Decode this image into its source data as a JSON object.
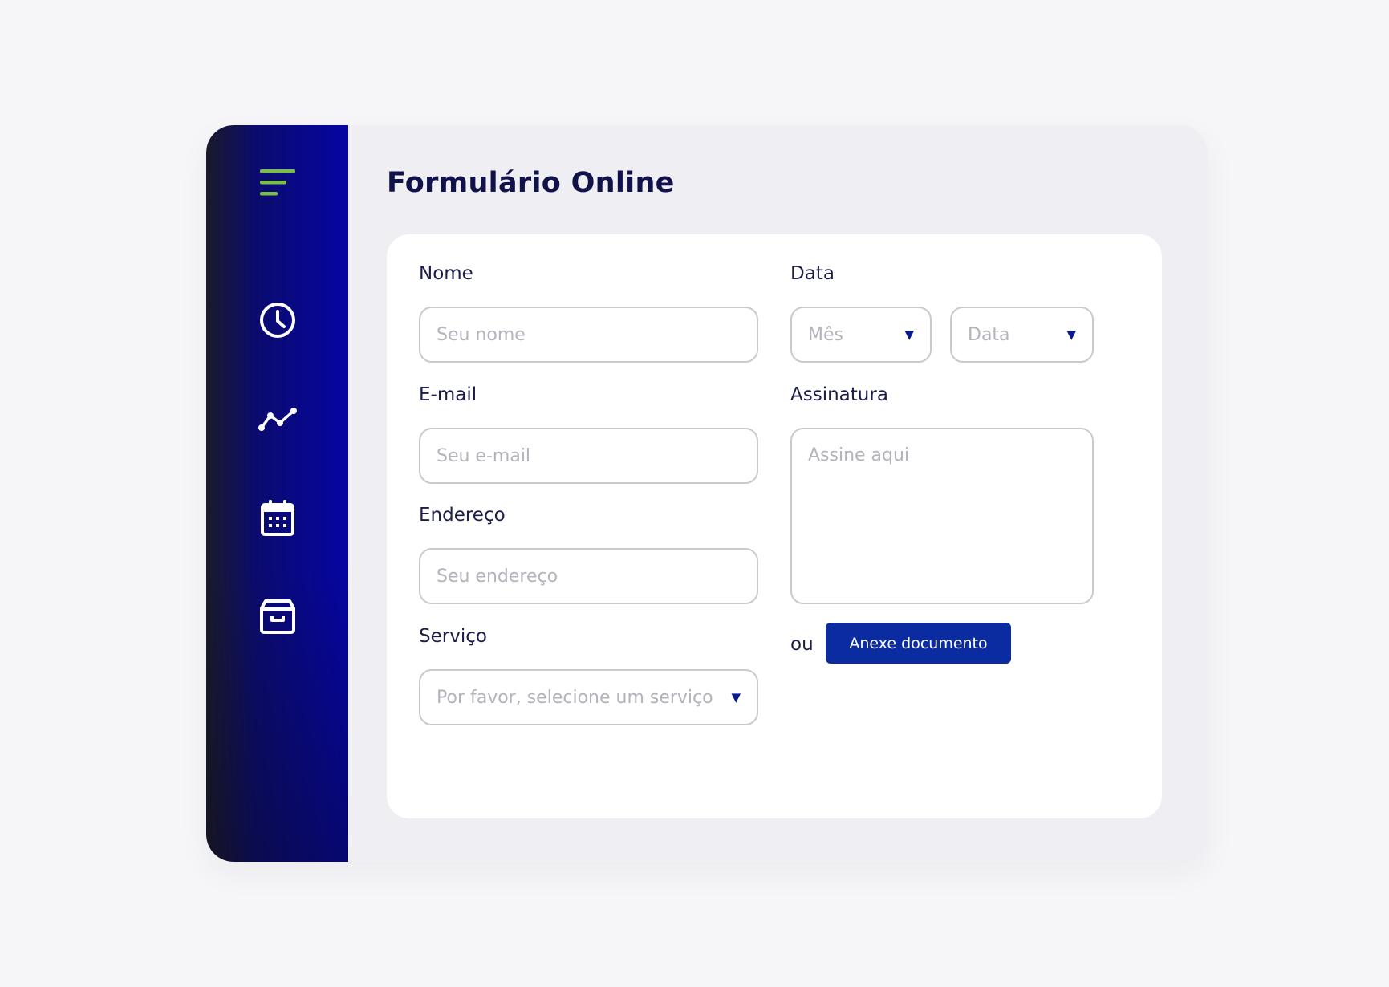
{
  "title": "Formulário Online",
  "form": {
    "name": {
      "label": "Nome",
      "placeholder": "Seu nome"
    },
    "email": {
      "label": "E-mail",
      "placeholder": "Seu e-mail"
    },
    "address": {
      "label": "Endereço",
      "placeholder": "Seu endereço"
    },
    "service": {
      "label": "Serviço",
      "placeholder": "Por favor, selecione um serviço"
    },
    "date": {
      "label": "Data",
      "month_placeholder": "Mês",
      "day_placeholder": "Data"
    },
    "signature": {
      "label": "Assinatura",
      "placeholder": "Assine aqui"
    },
    "or_text": "ou",
    "attach_label": "Anexe documento"
  },
  "colors": {
    "accent_green": "#7ac143",
    "primary_blue": "#0a2ca0",
    "title_navy": "#12124a"
  },
  "icons": [
    "menu-icon",
    "clock-icon",
    "trend-icon",
    "calendar-icon",
    "archive-icon"
  ]
}
